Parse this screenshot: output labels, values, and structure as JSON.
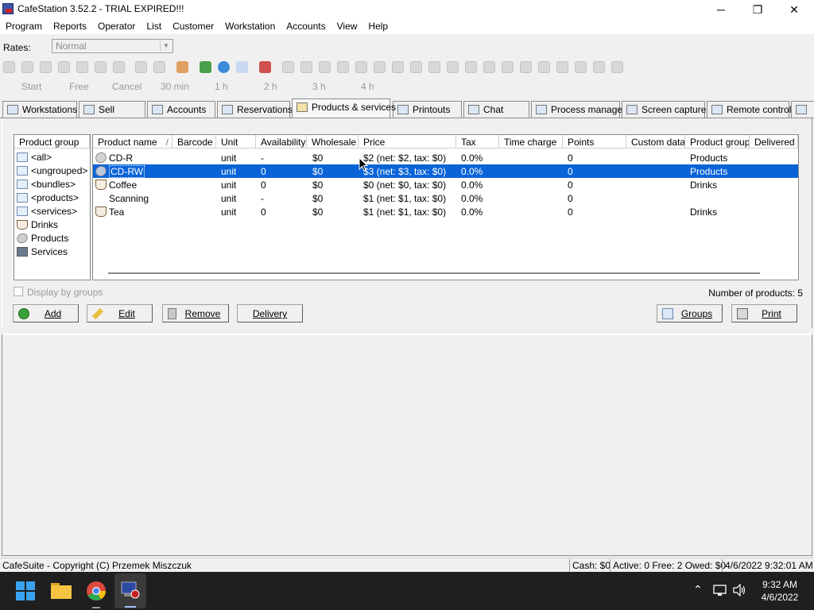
{
  "window": {
    "title": "CafeStation 3.52.2 - TRIAL EXPIRED!!!",
    "minimize": "─",
    "maximize": "❐",
    "close": "✕"
  },
  "menu": [
    "Program",
    "Reports",
    "Operator",
    "List",
    "Customer",
    "Workstation",
    "Accounts",
    "View",
    "Help"
  ],
  "rates": {
    "label": "Rates:",
    "value": "Normal"
  },
  "timebar": [
    "Start",
    "Free",
    "Cancel",
    "30 min",
    "1 h",
    "2 h",
    "3 h",
    "4 h"
  ],
  "tabs": [
    {
      "label": "Workstations",
      "icon": "workstations-icon"
    },
    {
      "label": "Sell",
      "icon": "cart-icon"
    },
    {
      "label": "Accounts",
      "icon": "accounts-icon"
    },
    {
      "label": "Reservations",
      "icon": "reservations-icon"
    },
    {
      "label": "Products & services",
      "icon": "products-icon",
      "active": true
    },
    {
      "label": "Printouts",
      "icon": "printer-icon"
    },
    {
      "label": "Chat",
      "icon": "chat-icon"
    },
    {
      "label": "Process manager",
      "icon": "process-icon"
    },
    {
      "label": "Screen capture",
      "icon": "screen-icon"
    },
    {
      "label": "Remote control",
      "icon": "remote-icon"
    }
  ],
  "groups": {
    "header": "Product group",
    "items": [
      {
        "label": "<all>",
        "icon": "list-icon"
      },
      {
        "label": "<ungrouped>",
        "icon": "list-icon"
      },
      {
        "label": "<bundles>",
        "icon": "list-icon"
      },
      {
        "label": "<products>",
        "icon": "list-icon"
      },
      {
        "label": "<services>",
        "icon": "list-icon"
      },
      {
        "label": "Drinks",
        "icon": "cup-icon"
      },
      {
        "label": "Products",
        "icon": "disk-icon"
      },
      {
        "label": "Services",
        "icon": "camera-icon"
      }
    ]
  },
  "products": {
    "columns": [
      "Product name",
      "Barcode",
      "Unit",
      "Availability",
      "Wholesale",
      "Price",
      "Tax",
      "Time charge",
      "Points",
      "Custom data",
      "Product group",
      "Delivered"
    ],
    "sort_indicator": "/",
    "rows": [
      {
        "icon": "disk",
        "name": "CD-R",
        "barcode": "",
        "unit": "unit",
        "availability": "-",
        "wholesale": "$0",
        "price": "$2 (net: $2, tax: $0)",
        "tax": "0.0%",
        "time_charge": "",
        "points": "0",
        "custom": "",
        "group": "Products",
        "delivered": ""
      },
      {
        "icon": "disk",
        "name": "CD-RW",
        "barcode": "",
        "unit": "unit",
        "availability": "0",
        "wholesale": "$0",
        "price": "$3 (net: $3, tax: $0)",
        "tax": "0.0%",
        "time_charge": "",
        "points": "0",
        "custom": "",
        "group": "Products",
        "delivered": "",
        "selected": true
      },
      {
        "icon": "cup",
        "name": "Coffee",
        "barcode": "",
        "unit": "unit",
        "availability": "0",
        "wholesale": "$0",
        "price": "$0 (net: $0, tax: $0)",
        "tax": "0.0%",
        "time_charge": "",
        "points": "0",
        "custom": "",
        "group": "Drinks",
        "delivered": ""
      },
      {
        "icon": "",
        "name": "Scanning",
        "barcode": "",
        "unit": "unit",
        "availability": "-",
        "wholesale": "$0",
        "price": "$1 (net: $1, tax: $0)",
        "tax": "0.0%",
        "time_charge": "",
        "points": "0",
        "custom": "",
        "group": "",
        "delivered": ""
      },
      {
        "icon": "cup",
        "name": "Tea",
        "barcode": "",
        "unit": "unit",
        "availability": "0",
        "wholesale": "$0",
        "price": "$1 (net: $1, tax: $0)",
        "tax": "0.0%",
        "time_charge": "",
        "points": "0",
        "custom": "",
        "group": "Drinks",
        "delivered": ""
      }
    ]
  },
  "display_by_groups": "Display by groups",
  "count": "Number of products: 5",
  "buttons": {
    "add": "Add",
    "edit": "Edit",
    "remove": "Remove",
    "delivery": "Delivery",
    "groups": "Groups",
    "print": "Print"
  },
  "status": {
    "copyright": "CafeSuite - Copyright (C) Przemek Miszczuk",
    "cash": "Cash: $0",
    "active": "Active: 0 Free: 2 Owed: $0",
    "datetime": "4/6/2022 9:32:01 AM"
  },
  "taskbar": {
    "time": "9:32 AM",
    "date": "4/6/2022"
  },
  "colors": {
    "selection": "#0a64d8",
    "taskbar": "#1f1f1f"
  }
}
